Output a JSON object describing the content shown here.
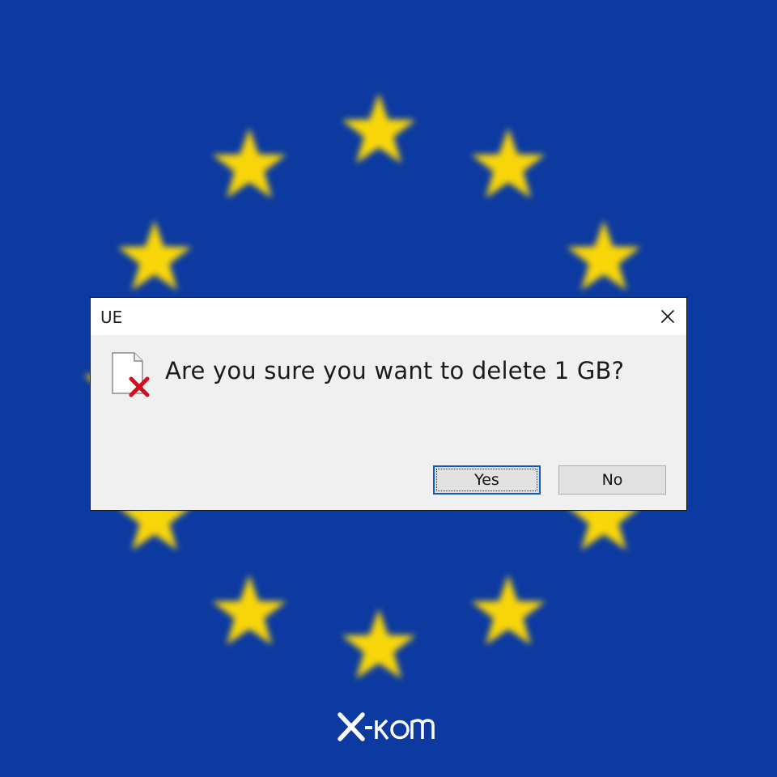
{
  "background": {
    "flag_blue": "#0c3aa0",
    "star_color": "#f9d60a"
  },
  "dialog": {
    "title": "UE",
    "message": "Are you sure you want to delete 1 GB?",
    "icon": "file-delete-icon",
    "close_icon": "close-icon",
    "buttons": {
      "yes_label": "Yes",
      "no_label": "No"
    },
    "focus_color": "#0a5ac8"
  },
  "brand": {
    "logo_text": "x-kom",
    "logo_color": "#ffffff"
  }
}
